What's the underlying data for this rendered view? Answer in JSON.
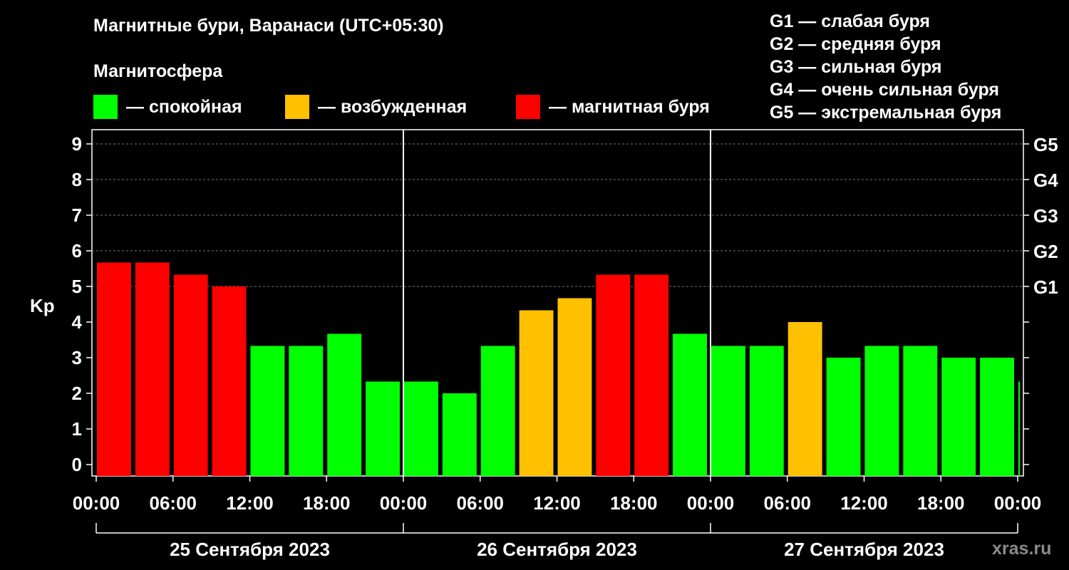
{
  "title": "Магнитные бури, Варанаси (UTC+05:30)",
  "subtitle": "Магнитосфера",
  "legend": [
    {
      "label": "— спокойная",
      "color": "#00ff00"
    },
    {
      "label": "— возбужденная",
      "color": "#ffc000"
    },
    {
      "label": "— магнитная буря",
      "color": "#ff0000"
    }
  ],
  "g_scale": [
    "G1 — слабая буря",
    "G2 — средняя буря",
    "G3 — сильная буря",
    "G4 — очень сильная буря",
    "G5 — экстремальная буря"
  ],
  "watermark": "xras.ru",
  "chart_data": {
    "type": "bar",
    "ylabel": "Kp",
    "ylim": [
      0,
      9
    ],
    "yticks": [
      "0",
      "1",
      "2",
      "3",
      "4",
      "5",
      "6",
      "7",
      "8",
      "9"
    ],
    "right_axis": [
      {
        "label": "G1",
        "kp": 5
      },
      {
        "label": "G2",
        "kp": 6
      },
      {
        "label": "G3",
        "kp": 7
      },
      {
        "label": "G4",
        "kp": 8
      },
      {
        "label": "G5",
        "kp": 9
      }
    ],
    "xticks": [
      "00:00",
      "06:00",
      "12:00",
      "18:00",
      "00:00",
      "06:00",
      "12:00",
      "18:00",
      "00:00",
      "06:00",
      "12:00",
      "18:00",
      "00:00"
    ],
    "days": [
      "25 Сентября 2023",
      "26 Сентября 2023",
      "27 Сентября 2023"
    ],
    "grid": true,
    "colors": {
      "quiet": "#00ff00",
      "active": "#ffc000",
      "storm": "#ff0000"
    },
    "values": [
      5.67,
      5.67,
      5.33,
      5.0,
      3.33,
      3.33,
      3.67,
      2.33,
      2.33,
      2.0,
      3.33,
      4.33,
      4.67,
      5.33,
      5.33,
      3.67,
      3.33,
      3.33,
      4.0,
      3.0,
      3.33,
      3.33,
      3.0,
      3.0,
      2.33
    ],
    "status": [
      "storm",
      "storm",
      "storm",
      "storm",
      "quiet",
      "quiet",
      "quiet",
      "quiet",
      "quiet",
      "quiet",
      "quiet",
      "active",
      "active",
      "storm",
      "storm",
      "quiet",
      "quiet",
      "quiet",
      "active",
      "quiet",
      "quiet",
      "quiet",
      "quiet",
      "quiet",
      "quiet"
    ]
  }
}
